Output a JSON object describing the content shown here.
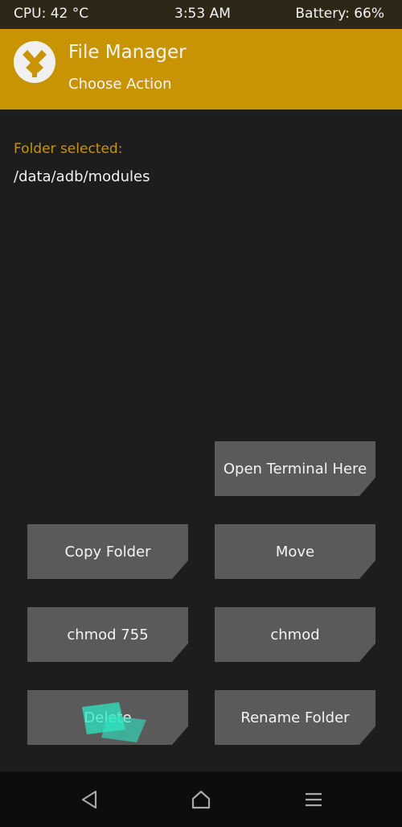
{
  "statusbar": {
    "cpu": "CPU: 42 °C",
    "time": "3:53 AM",
    "battery": "Battery: 66%"
  },
  "header": {
    "title": "File Manager",
    "subtitle": "Choose Action",
    "logo_icon": "twrp-logo-icon"
  },
  "content": {
    "folder_label": "Folder selected:",
    "folder_path": "/data/adb/modules"
  },
  "buttons": {
    "open_terminal": "Open Terminal Here",
    "copy_folder": "Copy Folder",
    "move": "Move",
    "chmod_755": "chmod 755",
    "chmod": "chmod",
    "delete": "Delete",
    "rename_folder": "Rename Folder"
  },
  "navbar": {
    "back_icon": "back-triangle-icon",
    "home_icon": "home-icon",
    "menu_icon": "menu-icon"
  },
  "colors": {
    "accent": "#c99404",
    "background": "#1d1d1d",
    "button": "#5a5a5a",
    "touch_feedback": "#2ee8c4"
  }
}
